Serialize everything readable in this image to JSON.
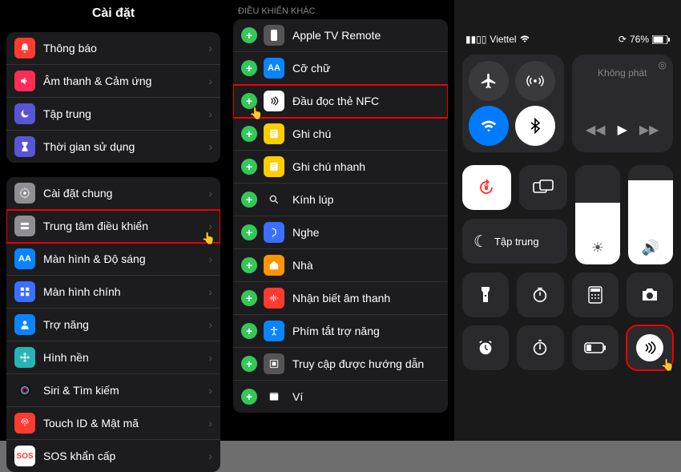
{
  "p1": {
    "title": "Cài đặt",
    "group1": [
      {
        "label": "Thông báo",
        "color": "#ff3b30",
        "icon": "bell"
      },
      {
        "label": "Âm thanh & Cảm ứng",
        "color": "#ff2d55",
        "icon": "speaker"
      },
      {
        "label": "Tập trung",
        "color": "#5856d6",
        "icon": "moon"
      },
      {
        "label": "Thời gian sử dụng",
        "color": "#5856d6",
        "icon": "hourglass"
      }
    ],
    "group2": [
      {
        "label": "Cài đặt chung",
        "color": "#8e8e93",
        "icon": "gear"
      },
      {
        "label": "Trung tâm điều khiển",
        "color": "#8e8e93",
        "icon": "switches",
        "hl": true,
        "cursor": true
      },
      {
        "label": "Màn hình & Độ sáng",
        "color": "#0a84ff",
        "icon": "AA"
      },
      {
        "label": "Màn hình chính",
        "color": "#3a6fff",
        "icon": "grid"
      },
      {
        "label": "Trợ năng",
        "color": "#0a84ff",
        "icon": "person"
      },
      {
        "label": "Hình nền",
        "color": "#28b4b4",
        "icon": "flower"
      },
      {
        "label": "Siri & Tìm kiếm",
        "color": "#1c1c1e",
        "icon": "siri"
      },
      {
        "label": "Touch ID & Mật mã",
        "color": "#ff3b30",
        "icon": "finger"
      },
      {
        "label": "SOS khẩn cấp",
        "color": "#ffffff",
        "icon": "SOS",
        "fg": "#ff3b30"
      }
    ]
  },
  "p2": {
    "section": "ĐIỀU KHIỂN KHÁC",
    "items": [
      {
        "label": "Apple TV Remote",
        "color": "#555",
        "icon": "remote"
      },
      {
        "label": "Cỡ chữ",
        "color": "#0a84ff",
        "icon": "AA"
      },
      {
        "label": "Đầu đọc thẻ NFC",
        "color": "#ffffff",
        "icon": "nfc",
        "hl": true,
        "cursor": true,
        "fg": "#000"
      },
      {
        "label": "Ghi chú",
        "color": "#ffcc00",
        "icon": "note"
      },
      {
        "label": "Ghi chú nhanh",
        "color": "#ffcc00",
        "icon": "qnote"
      },
      {
        "label": "Kính lúp",
        "color": "#1c1c1e",
        "icon": "mag"
      },
      {
        "label": "Nghe",
        "color": "#3a6fff",
        "icon": "ear"
      },
      {
        "label": "Nhà",
        "color": "#ff9500",
        "icon": "home"
      },
      {
        "label": "Nhận biết âm thanh",
        "color": "#ff3b30",
        "icon": "soundrec"
      },
      {
        "label": "Phím tắt trợ năng",
        "color": "#0a84ff",
        "icon": "access"
      },
      {
        "label": "Truy cập được hướng dẫn",
        "color": "#555",
        "icon": "guide"
      },
      {
        "label": "Ví",
        "color": "#1c1c1e",
        "icon": "wallet"
      }
    ]
  },
  "p3": {
    "carrier": "Viettel",
    "battery": "76%",
    "music_label": "Không phát",
    "focus_label": "Tập trung",
    "brightness": 62,
    "volume": 85
  }
}
